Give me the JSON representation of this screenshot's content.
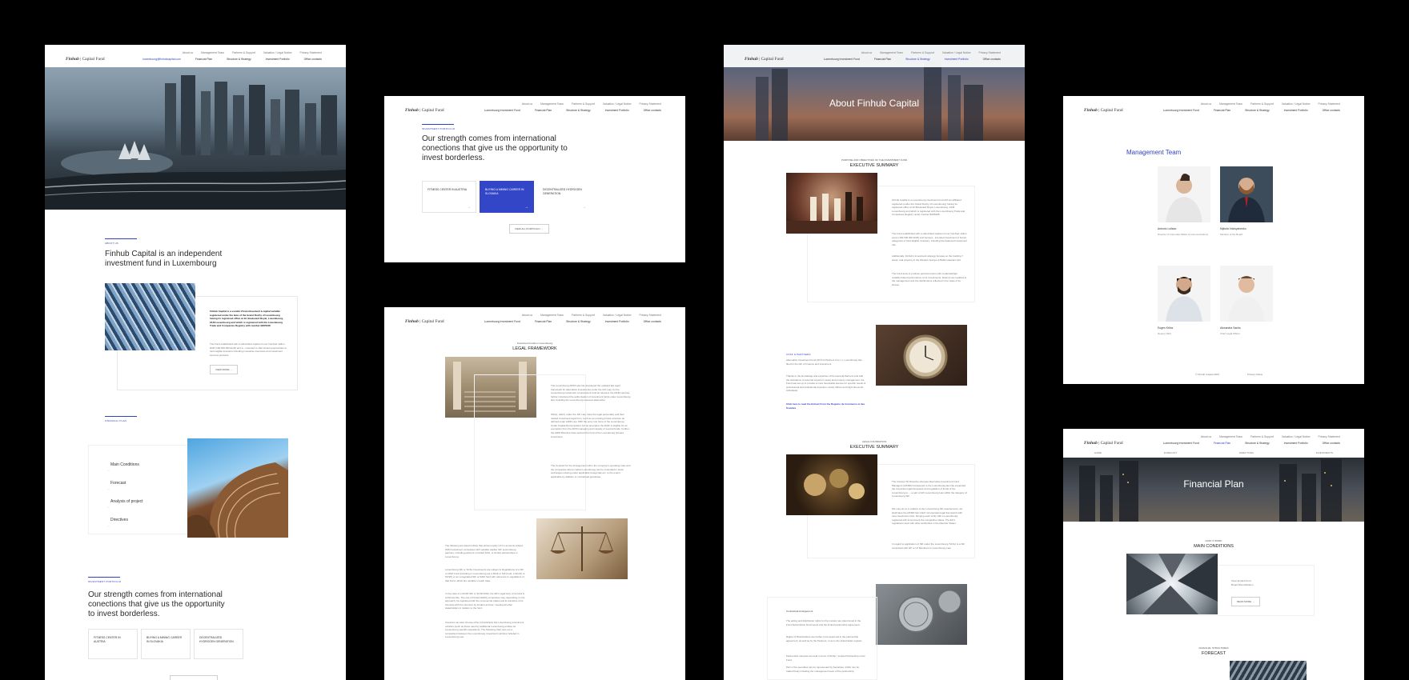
{
  "nav": {
    "logo_brand": "Finhub",
    "logo_suffix": "| Capital Fund",
    "top_links": [
      "About us",
      "Management Team",
      "Partners & Support",
      "Valuation / Legal Notice",
      "Privacy Statement"
    ],
    "email": "luxembourg@finhubcapital.com",
    "main_links": [
      "Luxembourg Investment Fund",
      "Financial Plan",
      "Structure & Strategy",
      "Investment Portfolio",
      "Office contacts"
    ]
  },
  "home": {
    "about_label": "ABOUT US",
    "about_headline": "Finhub Capital is an independent investment fund in Luxembourg",
    "about_bold": "Finhub Capital is a société d'investissement à capital variable registered under the laws of the Grand Duchy of Luxembourg having its registered office at 42, Boulevard Royal, Luxembourg, 2449 Luxembourg and which is registered with the Luxembourg Trade and Companies Registry with number B265438",
    "about_text": "The Fund established with a subscribed capital of over hundred million EUR (100.000.000 EUR) and is - intended to offer broad opportunities to fund eligible investors including innovative insurance and investment services products.",
    "view_more": "VIEW MORE",
    "financial_label": "FINANCIAL PLAN",
    "plan_items": [
      "Main Conditions",
      "Forecast",
      "Analysis of project",
      "Directives"
    ],
    "portfolio_label": "INVESTMENT PORTFOLIO",
    "portfolio_headline": "Our strength comes from international conections that give us the opportunity to invest borderless.",
    "projects": [
      "FITNESS CENTER IN AUSTRIA",
      "BUYING A MINING CAREER IN SLOVAKIA",
      "DECENTRALIZED HYDROGEN GENERATION"
    ]
  },
  "portfolio_page": {
    "label": "INVESTMENT PORTFOLIO",
    "headline": "Our strength comes from international conections that give us the opportunity to invest borderless.",
    "projects": [
      "FITNESS CENTER IN AUSTRIA",
      "BUYING A MINING CAREER IN SLOVAKIA",
      "DECENTRALIZED HYDROGEN GENERATION"
    ],
    "view_all": "VIEW ALL PORTFOLIO"
  },
  "legal_page": {
    "caption": "Investment Funds in Luxembourg",
    "title": "LEGAL FRAMEWORK",
    "para1": "The Luxembourg AIFM Law has developed the updated law legal framework for alternative investments under the UCI Law, for the Luxembourg investment compartment fund as relevant; the AIFM Law has further introduced the authorisation of investment funds under Luxembourg law, including the Luxembourg reserved alternative.",
    "para2": "SIF(s), which, under the SIF Law, have the legal personality and their related investment legal form, such as an existing private structure as defined under AIFM Law. With the entry into force of the Luxembourg Under Capital Remuneration Act as amended, the RAIF is eligible for an exemption from the AIFM managing and custody of several funds. Further, the AIFM Directive have opened the fund of the Luxembourg Quoted investment.",
    "para3": "The Contract for the Arrangement will in the company's operating rules and the companies where market Luxembourg can be controlled in stock exchanges existing under applicable foreign law etc. to the extent applicable by addition or contractual guarantee.",
    "para4": "The following are listed entities that pursuit equity UCI in amounts subject (SIF) Investment companies with variable capital, SIF Luxembourg partners, including partners in limited SCS, or limited partnerships in Luxembourg.",
    "para5": "Luxembourg SIF or SCSp Investments are subject to Regulations of a SIF or RAIF Fund including in Luxembourg (as a RAIF or SIF Fund, a SICAV or SCSP) or an unregulated SIF or RAIF fund with reference to regulations of that Fund, which are variable in each case.",
    "para6": "In the case of a SCSP SIF or SCSP RAIF, the SIF's legal form of its fund is a Partnership. The use of limited liability companies may, depending on the approach, be registered with the commercial trades and its transfers of its interests with the structure by lenders and tax, meeting all other stakeholders in relation to the fund.",
    "para7": "Investors can also choose other (Unsolicited) Not Luxembourg investment vehicles (such as those used by additional Luxembourg entities for Luxembourg specific operations). The following chart sets out a comparison between the Luxembourg investment vehicles included in Luxembourg Law."
  },
  "about_page": {
    "hero_title": "About Finhub Capital",
    "cap1": "PURPOSE AND OBJECTIVES OF THE INVESTMENT FUND",
    "title1": "EXECUTIVE SUMMARY",
    "bullet_text": "Finhub Capital is a Luxembourg investment fund with an affiliated registered (under the Grand Duchy of Luxembourg) having its registered office at 42 Boulevard Royal, Luxembourg, 2449 Luxembourg and which is registered with the Luxembourg Trade and Companies Registry under number B265438.",
    "para_a": "The Fund established with a subscribed capital of over hundred million euros (100.000.000 EUR) and focuses - intended investment of broad categories of fund-eligible investors, including the balanced investment risk.",
    "para_b": "Additionally, Finhub's investment strategy focuses on the building 7 areas: real property in the Western Europe & Baltic's Eastern EU.",
    "para_c": "The Fund aims to produce optimal returns with moderate/high volatility-linked performance of its investments. Returns are realized to the management and the distributions reflected in the value of its shares.",
    "cap2": "CSSF & PARTNERS",
    "para_d": "Alternative Investment Fund (SCS & Partners S.a r.l.), Luxembourg has filed for the AIF of Finance and investment.",
    "para_e": "Thanks to the knowledge and expertise of the General Partners and with the assistance of external experts in asset and property management, the Fund was set up to provide a more favourable avenue for specific needs of professional and institutional investors, family offices and High Net-worth individuals.",
    "link": "Click here to read the Extract From the Registre de Commerce et des Sociétés",
    "cap3": "LEGAL FOUNDATION",
    "title3": "EXECUTIVE SUMMARY",
    "para_f": "The Investor (5) Directive whereas Alternative Investment Fund Managers (AIFMD) transposed to the Luxembourg law has expanded the corporate legal framework and regulation of funds of the Luxembourg to - - a part of AIF Luxembourg Law within the category of Luxembourg SIF.",
    "para_g": "We may do so in relation to the Luxembourg SIF requirements, we shall have the AIFMD law which incorporates legal framework with new investment rules, bringing each entity with a Luxembourg-registered AIF and prevent the competitive status. The EC's regulations work with other authorities in the Member States.",
    "para_h": "In regard to application of SIF under the Luxembourg 'SCSp' is a SIF comprised with GP or LP Members to Luxembourg Law.",
    "para_i": "Contractual Arrangement",
    "para_j": "The acting and distribution rights for the investor are determined in the Fund Subscription Documents and the limited partnership agreement.",
    "para_k": "Rights of Shareholders are further to be approved in the partnership agreement, as well as by the Partners, or as in the shareholder register.",
    "para_l": "Partnership interests are held in Form of SCSp / Limited Partnership in the Fund.",
    "para_m": "Part in the securities can be represented by Securities, which can be traded freely including the management team of the partnership."
  },
  "team_page": {
    "title": "Management Team",
    "people": [
      {
        "name": "Antonio Lollano",
        "role": "Director of Corporate Affairs & Communications"
      },
      {
        "name": "Mykola Volosyshenko",
        "role": "Member of the Board"
      },
      {
        "name": "Eugen Krilos",
        "role": "Deputy CEO"
      },
      {
        "name": "Alexandra Sachs",
        "role": "Chief Legal Officer"
      }
    ],
    "footer_left": "© Finhub Capital 2023",
    "footer_right": "Privacy Notice"
  },
  "plan_page": {
    "hero_title": "Financial Plan",
    "sub_links": [
      "HOME",
      "FORECAST",
      "DIRECTIVES",
      "INVESTMENTS"
    ],
    "cap1": "HOW IT WORK",
    "title1": "MAIN CONDITIONS",
    "bullets": [
      "Open Ended Fund",
      "Broad Diversification"
    ],
    "read_more": "READ MORE",
    "cap2": "FINANCIAL STRUCTURES",
    "title2": "FORECAST"
  },
  "colors": {
    "accent": "#3446c8",
    "background": "#000000"
  },
  "icons": [
    "arrow-right-icon"
  ]
}
